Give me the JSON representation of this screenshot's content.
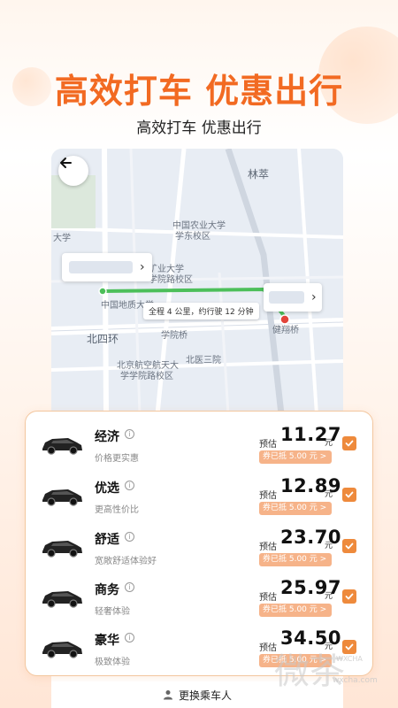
{
  "header": {
    "headline": "高效打车 优惠出行",
    "subheadline": "高效打车 优惠出行"
  },
  "map": {
    "labels": {
      "linzu": "林萃",
      "agri": "中国农业大学",
      "agri2": "学东校区",
      "daxue": "大学",
      "mining": "矿业大学",
      "mining2": "学院路校区",
      "geo": "中国地质大学",
      "sihuan": "北四环",
      "xueyuanqiao": "学院桥",
      "jianxiangqiao": "健翔桥",
      "beiyi": "北医三院",
      "beihang": "北京航空航天大",
      "beihang2": "学学院路校区"
    },
    "route_info": "全程 4 公里，约行驶 12 分钟"
  },
  "rides": [
    {
      "name": "经济",
      "desc": "价格更实惠",
      "est_label": "预估",
      "price": "11.27",
      "unit": "元",
      "coupon": "券已抵 5.00 元 >",
      "checked": true
    },
    {
      "name": "优选",
      "desc": "更高性价比",
      "est_label": "预估",
      "price": "12.89",
      "unit": "元",
      "coupon": "券已抵 5.00 元 >",
      "checked": true
    },
    {
      "name": "舒适",
      "desc": "宽敞舒适体验好",
      "est_label": "预估",
      "price": "23.70",
      "unit": "元",
      "coupon": "券已抵 5.00 元 >",
      "checked": true
    },
    {
      "name": "商务",
      "desc": "轻奢体验",
      "est_label": "预估",
      "price": "25.97",
      "unit": "元",
      "coupon": "券已抵 5.00 元 >",
      "checked": true
    },
    {
      "name": "豪华",
      "desc": "极致体验",
      "est_label": "预估",
      "price": "34.50",
      "unit": "元",
      "coupon": "券已抵 5.00 元 >",
      "checked": true
    }
  ],
  "bottom": {
    "change_passenger": "更换乘车人"
  },
  "watermark": {
    "text": "微茶",
    "small": "WXCHA",
    "url": "wxcha.com"
  },
  "colors": {
    "accent": "#f26a22",
    "check": "#ee8a3c",
    "coupon": "#f6b389"
  }
}
